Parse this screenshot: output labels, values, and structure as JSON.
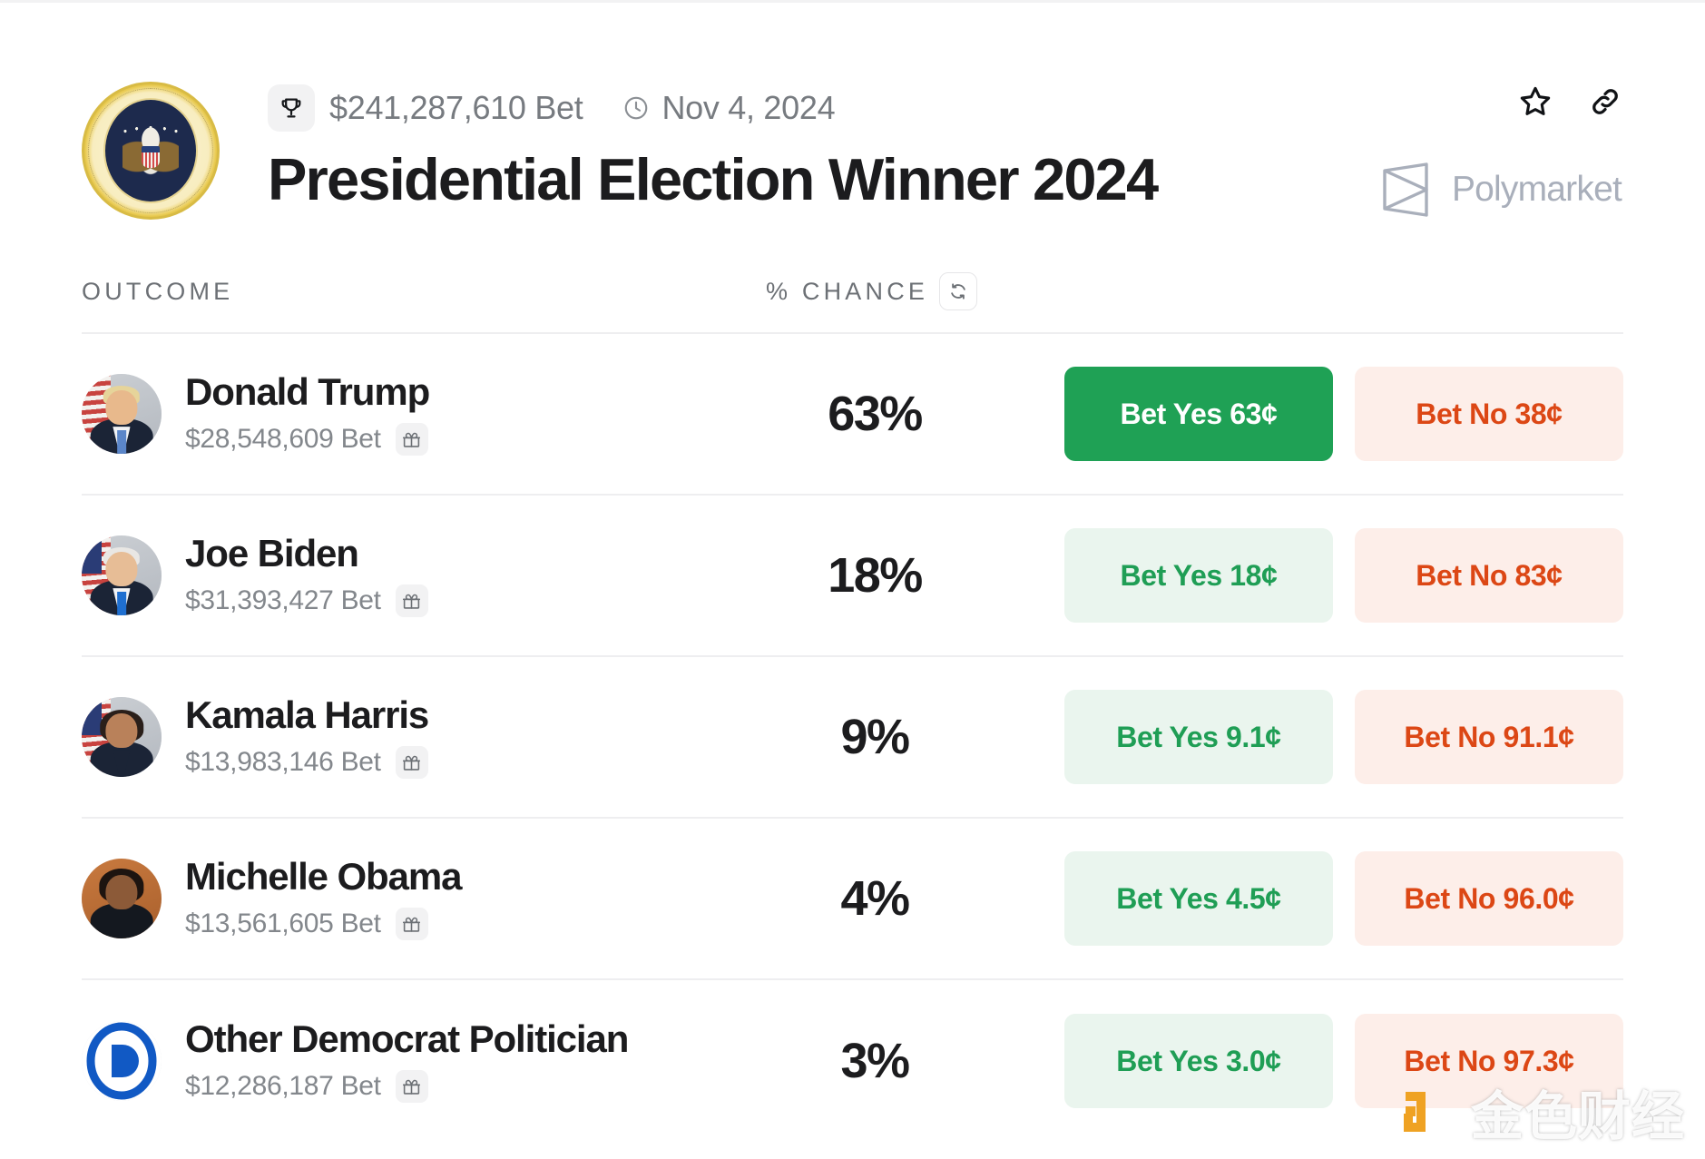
{
  "header": {
    "seal_icon": "presidential-seal",
    "trophy_icon": "trophy-icon",
    "bet_volume": "$241,287,610 Bet",
    "clock_icon": "clock-icon",
    "date": "Nov 4, 2024",
    "title": "Presidential Election Winner 2024",
    "star_icon": "star-icon",
    "link_icon": "link-icon",
    "brand_name": "Polymarket",
    "brand_logo_icon": "polymarket-logo-icon"
  },
  "table": {
    "col_outcome": "OUTCOME",
    "col_chance": "% CHANCE",
    "refresh_icon": "refresh-icon",
    "gift_icon": "gift-icon",
    "rows": [
      {
        "name": "Donald Trump",
        "amount": "$28,548,609 Bet",
        "chance": "63%",
        "yes_label": "Bet Yes 63¢",
        "no_label": "Bet No 38¢",
        "yes_primary": true,
        "avatar": "donald-trump-avatar"
      },
      {
        "name": "Joe Biden",
        "amount": "$31,393,427 Bet",
        "chance": "18%",
        "yes_label": "Bet Yes 18¢",
        "no_label": "Bet No 83¢",
        "yes_primary": false,
        "avatar": "joe-biden-avatar"
      },
      {
        "name": "Kamala Harris",
        "amount": "$13,983,146 Bet",
        "chance": "9%",
        "yes_label": "Bet Yes 9.1¢",
        "no_label": "Bet No 91.1¢",
        "yes_primary": false,
        "avatar": "kamala-harris-avatar"
      },
      {
        "name": "Michelle Obama",
        "amount": "$13,561,605 Bet",
        "chance": "4%",
        "yes_label": "Bet Yes 4.5¢",
        "no_label": "Bet No 96.0¢",
        "yes_primary": false,
        "avatar": "michelle-obama-avatar"
      },
      {
        "name": "Other Democrat Politician",
        "amount": "$12,286,187 Bet",
        "chance": "3%",
        "yes_label": "Bet Yes 3.0¢",
        "no_label": "Bet No 97.3¢",
        "yes_primary": false,
        "avatar": "democratic-party-logo"
      }
    ]
  },
  "watermark": {
    "text": "金色财经",
    "logo_icon": "jinse-logo-icon"
  },
  "colors": {
    "green": "#1fa155",
    "green_soft_bg": "#eaf5ee",
    "orange": "#dc4715",
    "orange_soft_bg": "#fdeee9",
    "text_dark": "#1c1c1e",
    "text_muted": "#83878c",
    "brand_gray": "#a9afbb",
    "dem_blue": "#1159c4"
  }
}
